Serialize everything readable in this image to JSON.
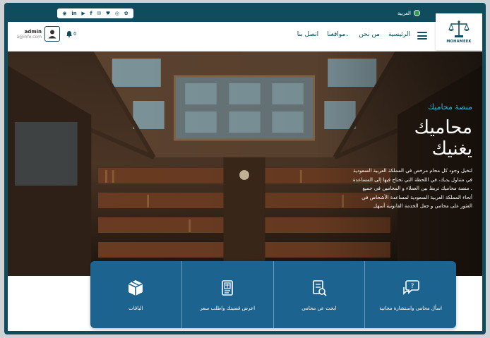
{
  "topbar": {
    "language": "العربية",
    "social_icons": [
      "instagram-icon",
      "linkedin-icon",
      "youtube-icon",
      "facebook-icon",
      "email-icon",
      "twitter-icon",
      "whatsapp-icon",
      "snapchat-icon"
    ],
    "social_glyphs": [
      "◉",
      "in",
      "▶",
      "f",
      "✉",
      "♥",
      "◎",
      "✿"
    ]
  },
  "logo": {
    "text": "MOHAMEEK"
  },
  "nav": {
    "items": [
      {
        "name": "nav-home",
        "label": "الرئيسية"
      },
      {
        "name": "nav-about",
        "label": "من نحن"
      },
      {
        "name": "nav-sites",
        "label": "مواقعنا",
        "dropdown": true
      },
      {
        "name": "nav-contact",
        "label": "اتصل بنا"
      }
    ],
    "dropdown_glyph": "⌄"
  },
  "user": {
    "name": "admin",
    "email": "a@info.com",
    "notifications": "0"
  },
  "hero": {
    "subtitle": "منصة محاميك",
    "title": "محاميك\nيغنيك",
    "description": "لتخيل وجود كل محام مرخص في المملكة العربية السعودية في متناول يديك، في اللحظة التي تحتاج فيها إلى المساعدة . منصة محاميك تربط بين العملاء و المحامين في جميع أنحاء المملكة العربية السعودية لمساعدة الأشخاص في العثور على محامي و جعل الخدمة القانونية أسهل"
  },
  "cards": [
    {
      "name": "card-ask-lawyer",
      "icon": "chat-question-icon",
      "label": "اسأل محامي واستشارة مجانية"
    },
    {
      "name": "card-find-lawyer",
      "icon": "document-search-icon",
      "label": "ابحث عن محامي"
    },
    {
      "name": "card-submit-case",
      "icon": "legal-document-icon",
      "label": "اعرض قضيتك واطلب سعر"
    },
    {
      "name": "card-packages",
      "icon": "package-icon",
      "label": "الباقات"
    }
  ],
  "colors": {
    "primary": "#0f4d5e",
    "accent": "#2db7c9",
    "cards": "#1c6390"
  }
}
